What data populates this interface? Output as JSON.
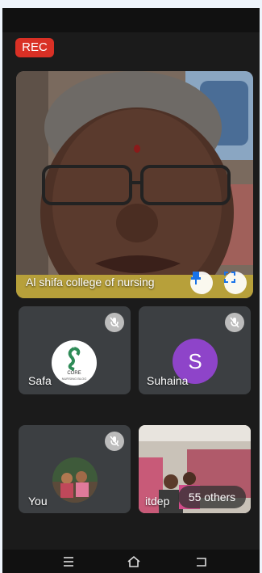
{
  "recording": {
    "label": "REC",
    "color": "#d93025"
  },
  "main_tile": {
    "name": "Al shifa college of nursing"
  },
  "participants": [
    {
      "name": "Safa",
      "avatar_text": "CORE",
      "avatar_subtext": "NURSING BLOG"
    },
    {
      "name": "Suhaina",
      "avatar_letter": "S",
      "avatar_color": "#8e44c9"
    },
    {
      "name": "You"
    },
    {
      "name": "itdep"
    }
  ],
  "others": {
    "label": "55 others"
  },
  "icons": {
    "pin": "pin-icon",
    "fullscreen": "fullscreen-icon",
    "mute": "mic-off-icon",
    "nav_recent": "recent-apps-icon",
    "nav_home": "home-icon",
    "nav_back": "back-icon"
  }
}
